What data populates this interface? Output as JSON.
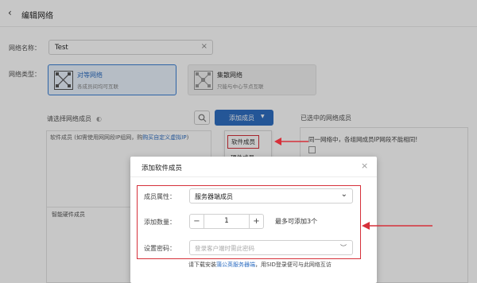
{
  "header": {
    "title": "编辑网络"
  },
  "form": {
    "name_label": "网络名称：",
    "name_value": "Test",
    "type_label": "网络类型：",
    "types": [
      {
        "name": "对等网络",
        "desc": "各成员间均可互联"
      },
      {
        "name": "集散网络",
        "desc": "只能与中心节点互联"
      }
    ]
  },
  "members": {
    "left_title": "请选择网络成员",
    "add_button": "添加成员",
    "software_prefix": "软件成员",
    "software_note": "(如需使用网网段IP组网，购",
    "software_link": "购买自定义虚拟IP",
    "software_suffix": ")",
    "hardware_label": "智能硬件成员",
    "dropdown": [
      "软件成员",
      "硬件成员"
    ],
    "right_title": "已选中的网络成员",
    "right_note": "同一网络中，各组网成员IP网段不能相同!"
  },
  "modal": {
    "title": "添加软件成员",
    "attr_label": "成员属性：",
    "attr_value": "服务器端成员",
    "count_label": "添加数量：",
    "count_value": "1",
    "count_hint": "最多可添加3个",
    "pwd_label": "设置密码：",
    "pwd_placeholder": "登录客户端时需此密码",
    "download_prefix": "请下载安装",
    "download_link": "蒲公英服务器端",
    "download_suffix": "，用SID登录便可与此网络互访"
  },
  "colors": {
    "accent": "#2f6fc2",
    "annotation": "#d6303a"
  }
}
